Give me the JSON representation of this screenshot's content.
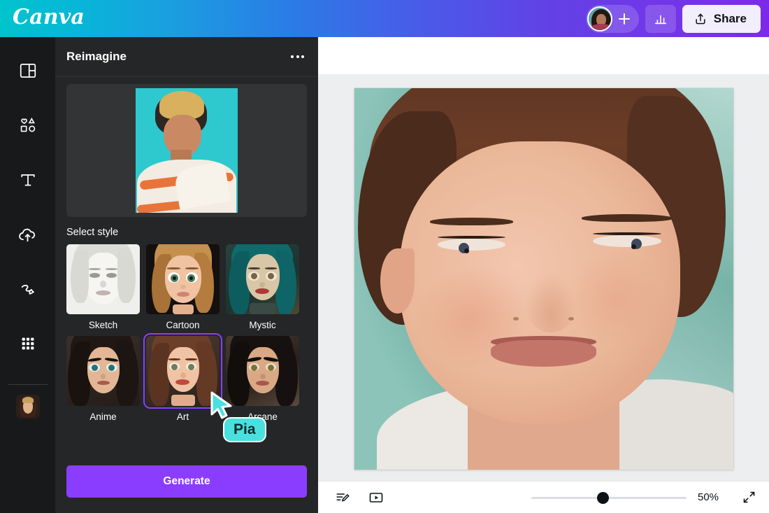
{
  "header": {
    "logo_text": "Canva",
    "avatar_icon": "user-avatar",
    "add_collaborator_icon": "plus-icon",
    "insights_icon": "bar-chart-icon",
    "share_icon": "share-upload-icon",
    "share_label": "Share"
  },
  "rail": {
    "items": [
      {
        "icon": "design-templates-icon",
        "name": "design"
      },
      {
        "icon": "elements-shapes-icon",
        "name": "elements"
      },
      {
        "icon": "text-icon",
        "name": "text"
      },
      {
        "icon": "cloud-upload-icon",
        "name": "uploads"
      },
      {
        "icon": "draw-pen-icon",
        "name": "draw"
      },
      {
        "icon": "apps-grid-icon",
        "name": "apps"
      }
    ],
    "thumbnail_icon": "portrait-thumbnail"
  },
  "panel": {
    "title": "Reimagine",
    "more_icon": "more-options-icon",
    "source_image_alt": "source-portrait-photo",
    "section_label": "Select style",
    "styles": [
      {
        "label": "Sketch",
        "selected": false
      },
      {
        "label": "Cartoon",
        "selected": false
      },
      {
        "label": "Mystic",
        "selected": false
      },
      {
        "label": "Anime",
        "selected": false
      },
      {
        "label": "Art",
        "selected": true
      },
      {
        "label": "Arcane",
        "selected": false
      }
    ],
    "generate_label": "Generate"
  },
  "canvas": {
    "artwork_alt": "reimagined-painted-portrait"
  },
  "bottom_bar": {
    "notes_icon": "notes-icon",
    "present_icon": "present-play-icon",
    "zoom_value": "50%",
    "zoom_percent": 50,
    "slider_position_percent": 46,
    "fullscreen_icon": "expand-fullscreen-icon"
  },
  "cursor": {
    "label": "Pia",
    "color": "#4ae0e0"
  },
  "colors": {
    "accent_purple": "#8b3dff",
    "header_gradient_start": "#00c4cc",
    "header_gradient_end": "#7d2ae8",
    "panel_bg": "#252627",
    "rail_bg": "#18191b"
  }
}
